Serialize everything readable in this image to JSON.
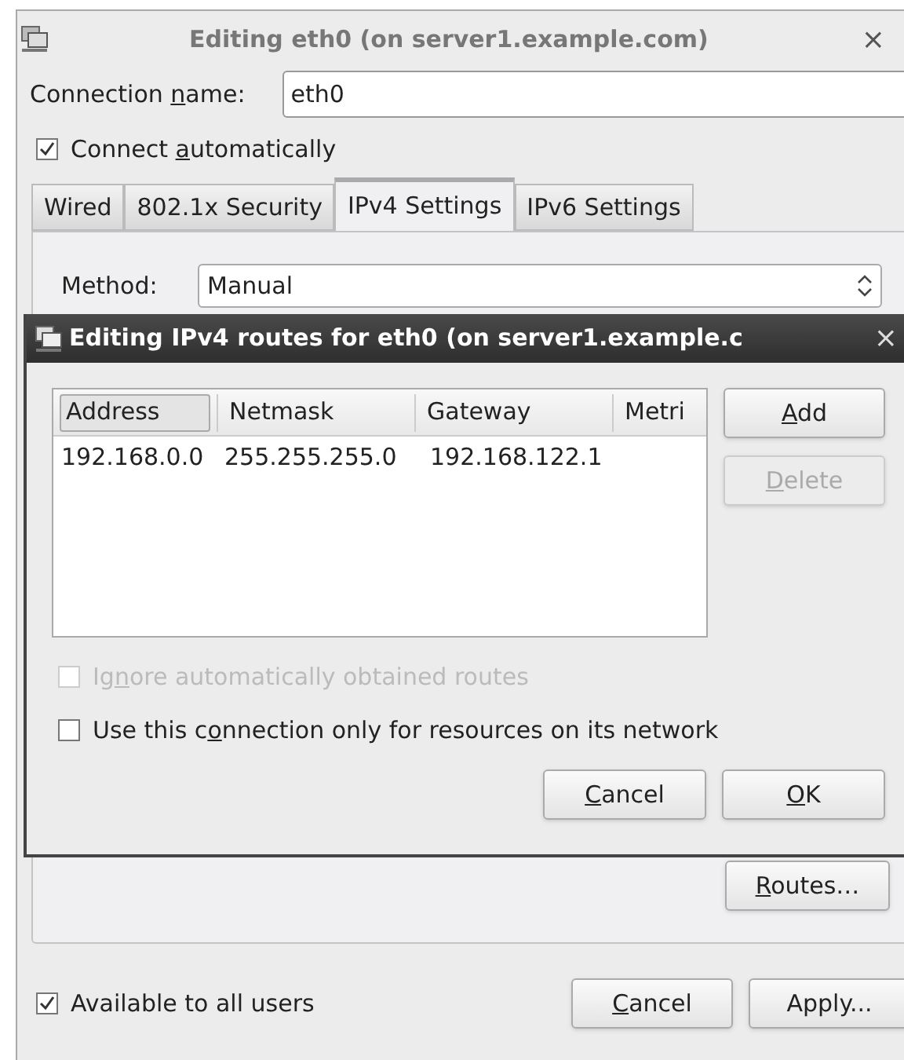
{
  "window": {
    "title": "Editing eth0 (on server1.example.com)",
    "close": "×",
    "connection_name": {
      "label": [
        {
          "text": "Connection "
        },
        {
          "text": "n",
          "underline": true
        },
        {
          "text": "ame:"
        }
      ],
      "value": "eth0"
    },
    "connect_automatically": {
      "label": [
        {
          "text": "Connect "
        },
        {
          "text": "a",
          "underline": true
        },
        {
          "text": "utomatically"
        }
      ],
      "checked": true
    },
    "tabs": [
      {
        "label": "Wired",
        "selected": false
      },
      {
        "label": "802.1x Security",
        "selected": false
      },
      {
        "label": "IPv4 Settings",
        "selected": true
      },
      {
        "label": "IPv6 Settings",
        "selected": false
      }
    ],
    "method": {
      "label": [
        {
          "text": "Method:"
        }
      ],
      "value": "Manual"
    },
    "routes_button": {
      "label": [
        {
          "text": "R",
          "underline": true
        },
        {
          "text": "outes…"
        }
      ]
    },
    "available_to_all_users": {
      "label": [
        {
          "text": "Available to all users"
        }
      ],
      "checked": true
    },
    "buttons": [
      {
        "label": [
          {
            "text": "C",
            "underline": true
          },
          {
            "text": "ancel"
          }
        ]
      },
      {
        "label": [
          {
            "text": "Apply..."
          }
        ]
      }
    ]
  },
  "routes_dialog": {
    "title": "Editing IPv4 routes for eth0 (on server1.example.c",
    "close": "×",
    "table": {
      "columns": [
        "Address",
        "Netmask",
        "Gateway",
        "Metri"
      ],
      "rows": [
        [
          "192.168.0.0",
          "255.255.255.0",
          "192.168.122.1"
        ]
      ]
    },
    "side_buttons": [
      {
        "label": [
          {
            "text": "A",
            "underline": true
          },
          {
            "text": "dd"
          }
        ],
        "disabled": false
      },
      {
        "label": [
          {
            "text": "D",
            "underline": true
          },
          {
            "text": "elete"
          }
        ],
        "disabled": true
      }
    ],
    "options": [
      {
        "label": [
          {
            "text": "Ig"
          },
          {
            "text": "n",
            "underline": true
          },
          {
            "text": "ore automatically obtained routes"
          }
        ],
        "checked": false,
        "disabled": true
      },
      {
        "label": [
          {
            "text": "Use this c"
          },
          {
            "text": "o",
            "underline": true
          },
          {
            "text": "nnection only for resources on its network"
          }
        ],
        "checked": false,
        "disabled": false
      }
    ],
    "buttons": [
      {
        "label": [
          {
            "text": "C",
            "underline": true
          },
          {
            "text": "ancel"
          }
        ]
      },
      {
        "label": [
          {
            "text": "O",
            "underline": true
          },
          {
            "text": "K"
          }
        ]
      }
    ]
  }
}
